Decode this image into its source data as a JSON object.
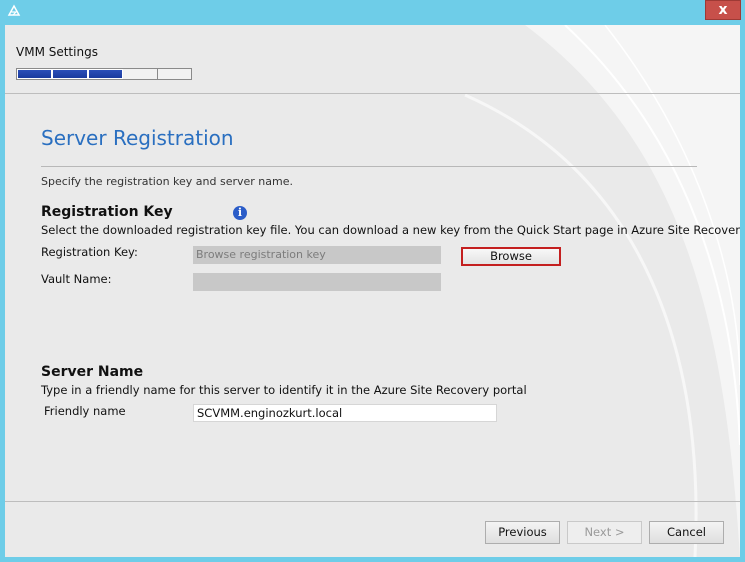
{
  "window": {
    "app_icon": "azure-site-recovery-icon",
    "close_glyph": "x"
  },
  "header": {
    "title": "VMM Settings",
    "progress": {
      "completed_steps": 3,
      "total_steps": 5
    }
  },
  "page": {
    "title": "Server Registration",
    "instruction": "Specify the registration key and server name."
  },
  "registration": {
    "heading": "Registration Key",
    "info_icon": "info-icon",
    "description": "Select the downloaded registration key file. You can download a new key from the Quick Start page in Azure Site Recovery",
    "key_label": "Registration Key:",
    "key_placeholder": "Browse registration key",
    "browse_label": "Browse",
    "vault_label": "Vault Name:",
    "vault_value": ""
  },
  "server": {
    "heading": "Server Name",
    "description": "Type in a friendly name for this server to identify it in the Azure Site Recovery portal",
    "friendly_label": "Friendly name",
    "friendly_value": "SCVMM.enginozkurt.local"
  },
  "footer": {
    "previous_label": "Previous",
    "next_label": "Next >",
    "cancel_label": "Cancel"
  },
  "colors": {
    "title_bar": "#6ecde8",
    "accent_blue": "#2a6fc0",
    "highlight_red": "#c41f1f",
    "progress_fill": "#1a3a9e"
  }
}
